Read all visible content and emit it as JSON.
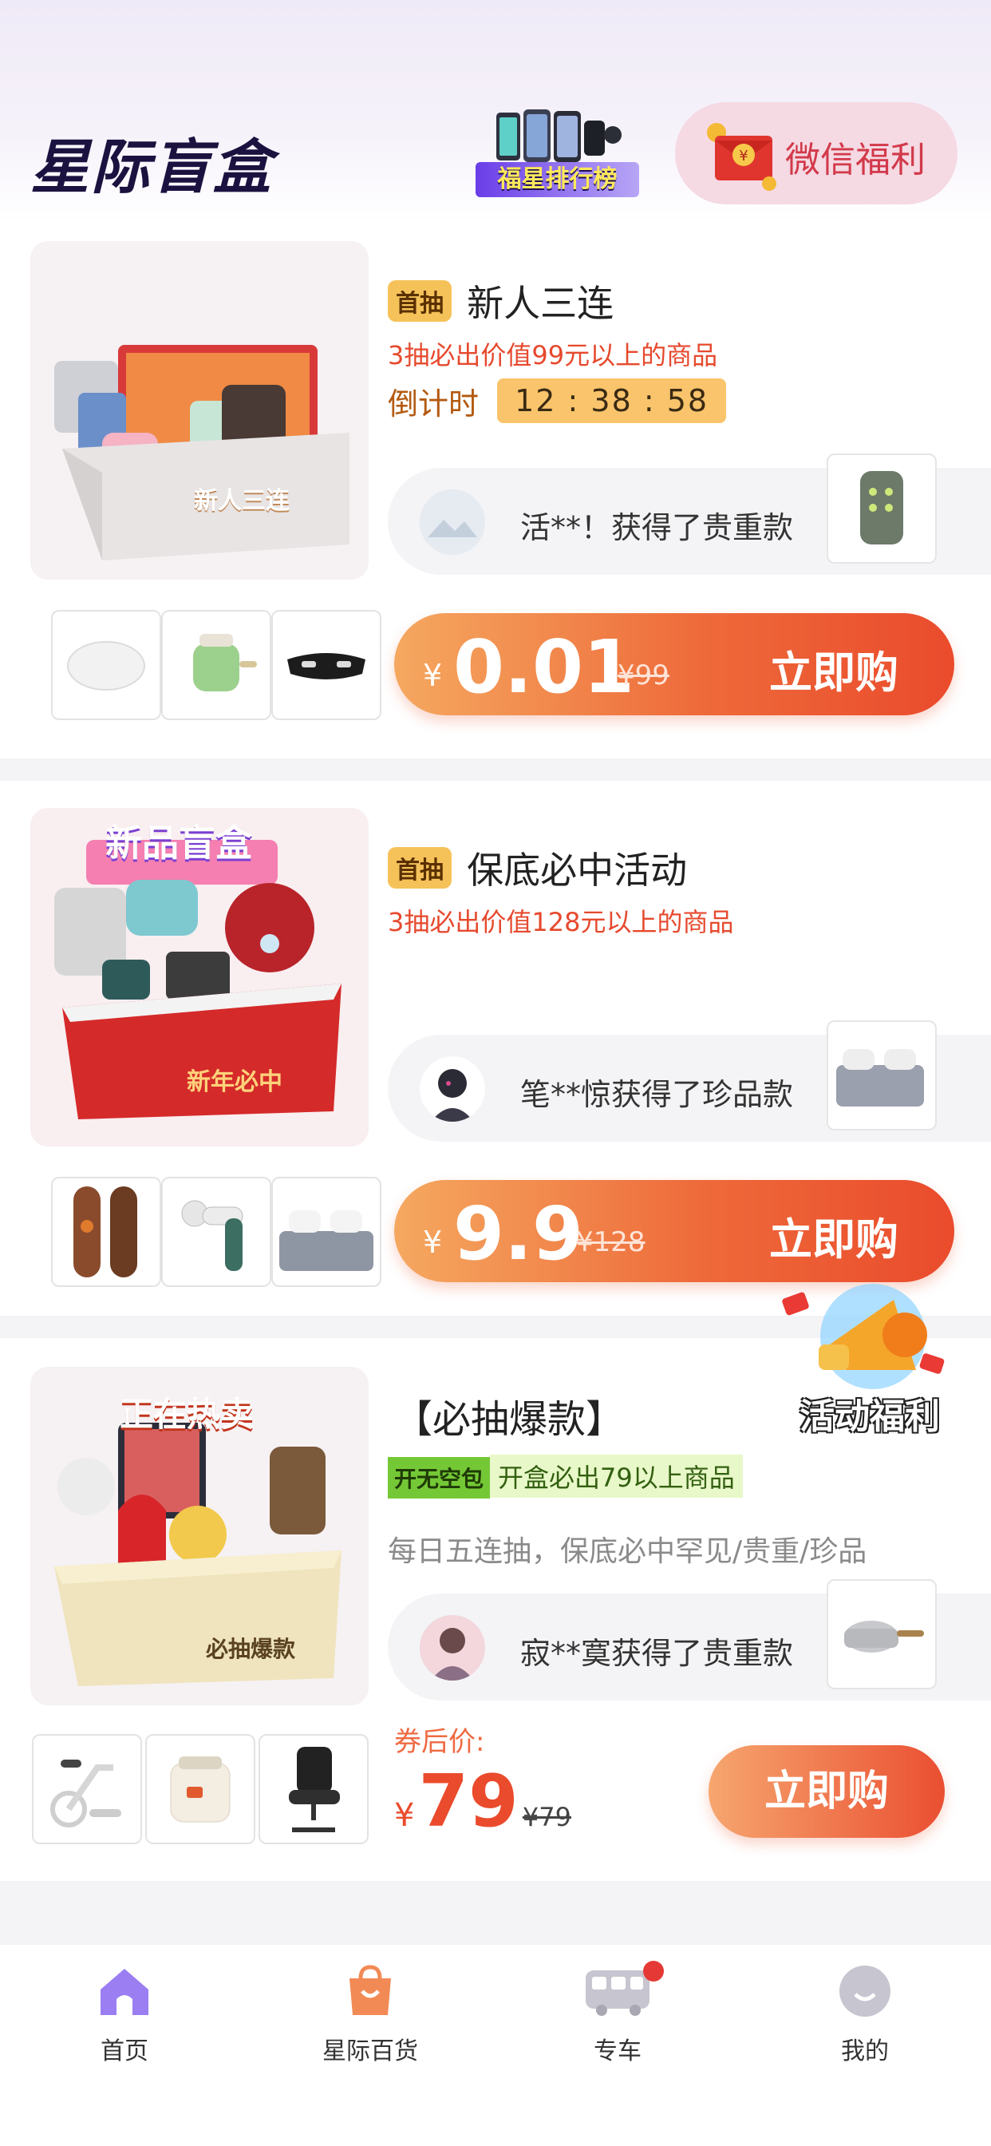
{
  "header": {
    "logo_text": "星际盲盒",
    "rank_label": "福星排行榜",
    "welfare_label": "微信福利"
  },
  "cards": [
    {
      "first_tag": "首抽",
      "title": "新人三连",
      "subtitle": "3抽必出价值99元以上的商品",
      "countdown_label": "倒计时",
      "countdown": "12 : 38 : 58",
      "box_caption": "新人三连",
      "winner_text": "活**！获得了贵重款",
      "price_yen": "¥",
      "price": "0.01",
      "original": "¥99",
      "cta": "立即购"
    },
    {
      "first_tag": "首抽",
      "title": "保底必中活动",
      "subtitle": "3抽必出价值128元以上的商品",
      "box_top_caption": "新品盲盒",
      "box_caption": "新年必中",
      "winner_text": "笔**惊获得了珍品款",
      "price_yen": "¥",
      "price": "9.9",
      "original": "¥128",
      "cta": "立即购"
    },
    {
      "title": "【必抽爆款】",
      "tag_green": "开无空包",
      "tag_light": "开盒必出79以上商品",
      "desc": "每日五连抽，保底必中罕见/贵重/珍品",
      "box_top_caption": "正在热卖",
      "box_caption": "必抽爆款",
      "winner_text": "寂**寞获得了贵重款",
      "after_label": "券后价:",
      "price_yen": "¥",
      "price": "79",
      "original": "¥79",
      "cta": "立即购"
    }
  ],
  "floating": {
    "activity_label": "活动福利"
  },
  "nav": {
    "items": [
      {
        "label": "首页",
        "icon": "home-icon",
        "color": "#9a7ef2"
      },
      {
        "label": "星际百货",
        "icon": "shopping-bag-icon",
        "color": "#f28a55"
      },
      {
        "label": "专车",
        "icon": "bus-icon",
        "color": "#c7c5cf"
      },
      {
        "label": "我的",
        "icon": "profile-icon",
        "color": "#c7c5cf"
      }
    ]
  },
  "colors": {
    "accent": "#ea4b2c",
    "tag": "#f5c25a",
    "green": "#74c836"
  }
}
